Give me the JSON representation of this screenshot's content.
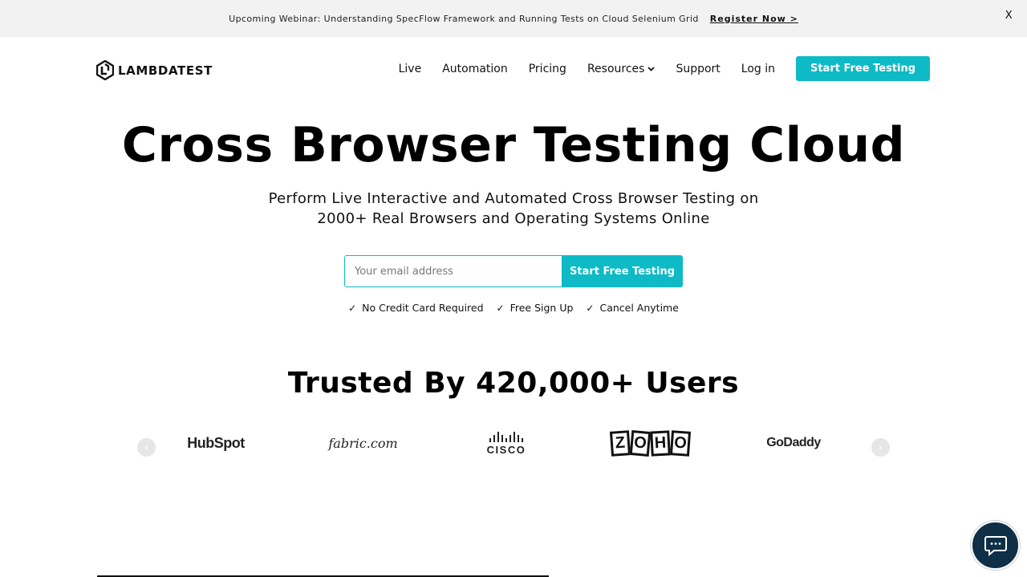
{
  "banner": {
    "text": "Upcoming Webinar: Understanding SpecFlow Framework and Running Tests on Cloud Selenium Grid",
    "link": "Register Now >",
    "close": "X"
  },
  "nav": {
    "logo": "LAMBDATEST",
    "items": [
      "Live",
      "Automation",
      "Pricing",
      "Resources",
      "Support",
      "Log in"
    ],
    "cta": "Start Free Testing"
  },
  "hero": {
    "title": "Cross Browser Testing Cloud",
    "subtitle_line1": "Perform Live Interactive and Automated Cross Browser Testing on",
    "subtitle_line2": "2000+ Real Browsers and Operating Systems Online",
    "email_placeholder": "Your email address",
    "cta": "Start Free Testing",
    "perks": [
      "No Credit Card Required",
      "Free Sign Up",
      "Cancel Anytime"
    ]
  },
  "trusted": {
    "title": "Trusted By 420,000+ Users",
    "brands": {
      "hubspot": "HubSpot",
      "fabric": "fabric.com",
      "cisco": "CISCO",
      "zoho": [
        "Z",
        "O",
        "H",
        "O"
      ],
      "godaddy": "GoDaddy"
    }
  },
  "colors": {
    "accent": "#0ebac5",
    "chat_bg": "#0f2f47",
    "banner_bg": "#f2f2f2"
  }
}
